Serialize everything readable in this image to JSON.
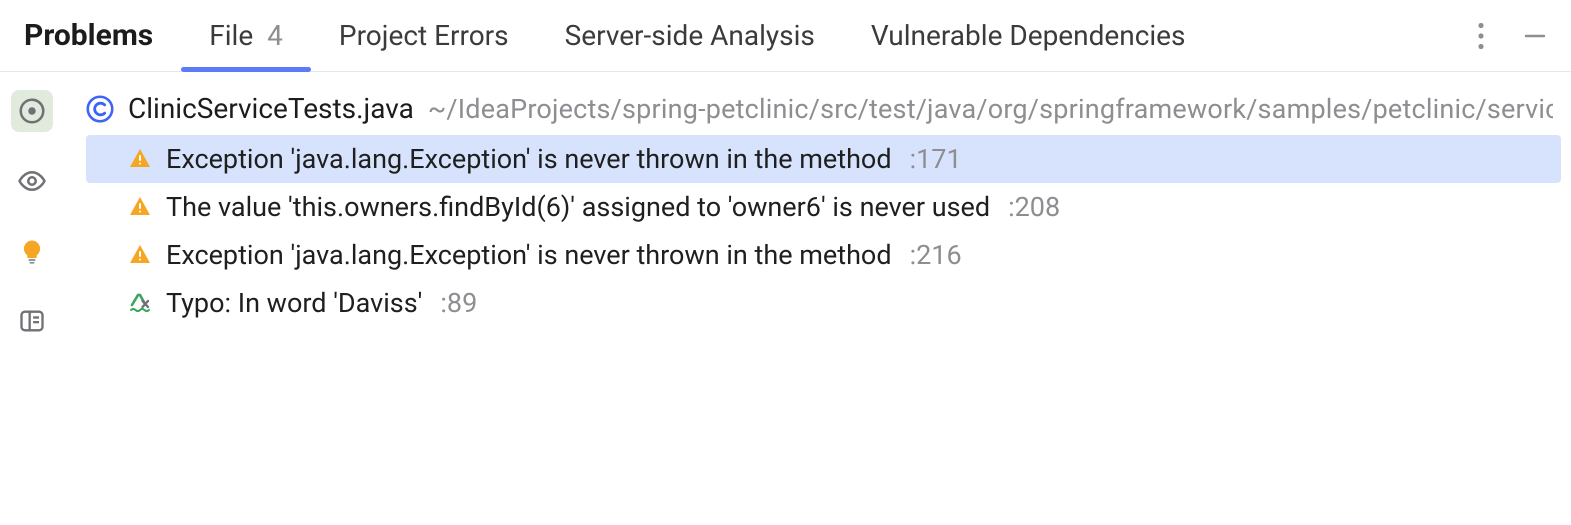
{
  "header": {
    "title": "Problems",
    "tabs": [
      {
        "id": "file",
        "label": "File",
        "count": "4",
        "active": true
      },
      {
        "id": "project",
        "label": "Project Errors"
      },
      {
        "id": "server",
        "label": "Server-side Analysis"
      },
      {
        "id": "vuln",
        "label": "Vulnerable Dependencies"
      }
    ]
  },
  "file": {
    "name": "ClinicServiceTests.java",
    "path": "~/IdeaProjects/spring-petclinic/src/test/java/org/springframework/samples/petclinic/service"
  },
  "issues": [
    {
      "type": "warning",
      "message": "Exception 'java.lang.Exception' is never thrown in the method",
      "line": ":171",
      "selected": true
    },
    {
      "type": "warning",
      "message": "The value 'this.owners.findById(6)' assigned to 'owner6' is never used",
      "line": ":208"
    },
    {
      "type": "warning",
      "message": "Exception 'java.lang.Exception' is never thrown in the method",
      "line": ":216"
    },
    {
      "type": "typo",
      "message": "Typo: In word 'Daviss'",
      "line": ":89"
    }
  ],
  "sideTools": [
    {
      "id": "target",
      "name": "inspections-target",
      "selected": true
    },
    {
      "id": "eye",
      "name": "highlighting-eye"
    },
    {
      "id": "bulb",
      "name": "intention-bulb"
    },
    {
      "id": "panel",
      "name": "panel-toggle"
    }
  ]
}
